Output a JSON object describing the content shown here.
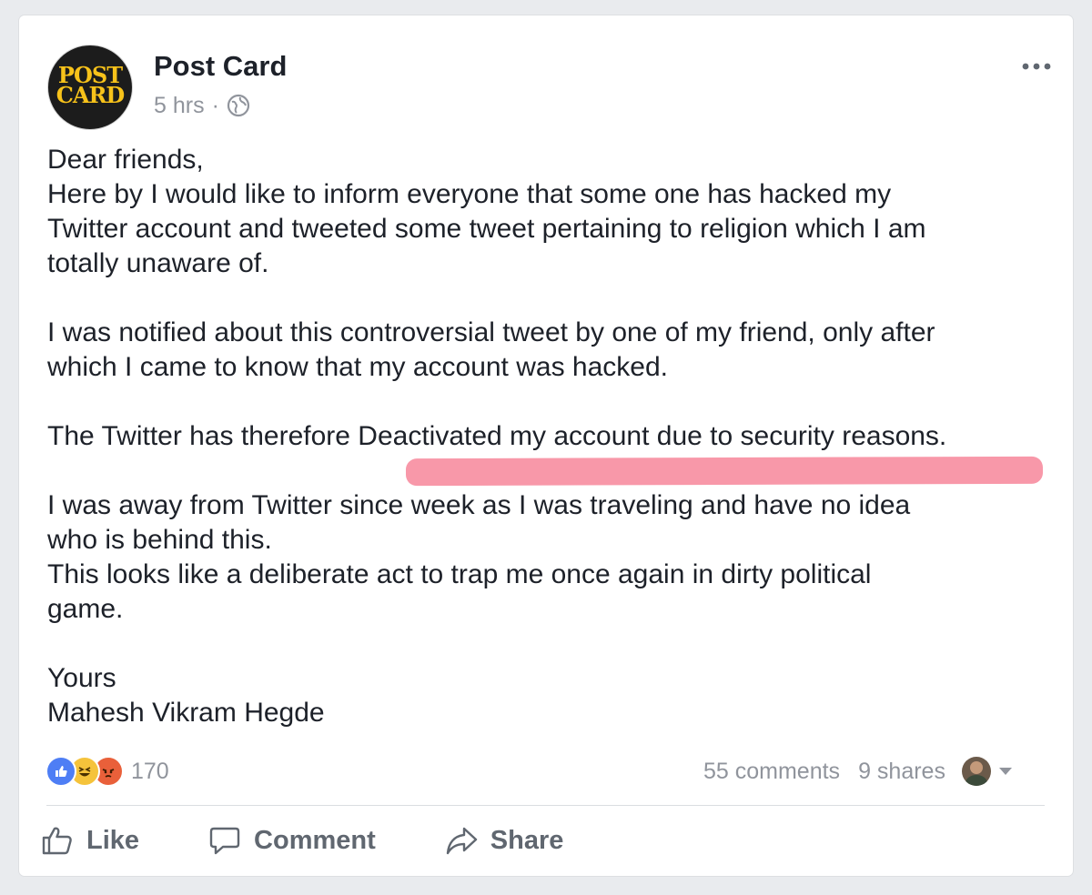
{
  "post": {
    "page_name": "Post Card",
    "avatar_text": [
      "POST",
      "CARD"
    ],
    "time": "5 hrs",
    "separator": "·",
    "privacy_icon": "globe-icon",
    "more_icon": "more-horizontal-icon",
    "body": {
      "greeting": "Dear friends,",
      "p1_lines": [
        "Here by I would like to inform everyone that some one has hacked my",
        "Twitter account and tweeted some tweet pertaining to religion which I am",
        "totally unaware of."
      ],
      "p2_lines": [
        "I was notified about this controversial tweet by one of my friend, only after",
        "which I came to know that my account was hacked."
      ],
      "p3_line": "The Twitter has therefore Deactivated my account due to security reasons.",
      "p4_lines": [
        "I was away from Twitter since week as I was traveling and have no idea",
        "who is behind this.",
        "This looks like a deliberate act to trap me once again in dirty political",
        "game."
      ],
      "closing": "Yours",
      "signature": "Mahesh Vikram Hegde"
    },
    "highlight_color": "#f7869a"
  },
  "stats": {
    "reaction_icons": [
      "like-reaction-icon",
      "haha-reaction-icon",
      "angry-reaction-icon"
    ],
    "reaction_count": "170",
    "comments": "55 comments",
    "shares": "9 shares"
  },
  "actions": {
    "like": "Like",
    "comment": "Comment",
    "share": "Share"
  },
  "colors": {
    "text": "#1d2129",
    "muted": "#90949c",
    "action": "#606770",
    "like_blue": "#4e7ef5"
  }
}
